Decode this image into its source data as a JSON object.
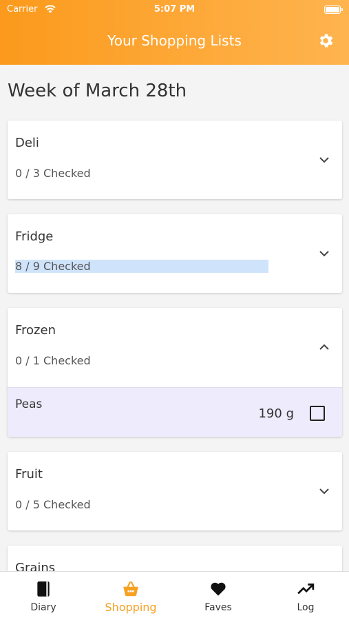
{
  "status": {
    "carrier": "Carrier",
    "time": "5:07 PM"
  },
  "header": {
    "title": "Your Shopping Lists"
  },
  "week_title": "Week of March 28th",
  "lists": [
    {
      "name": "Deli",
      "count": "0 / 3 Checked",
      "expanded": false
    },
    {
      "name": "Fridge",
      "count": "8 / 9 Checked",
      "expanded": false
    },
    {
      "name": "Frozen",
      "count": "0 / 1 Checked",
      "expanded": true,
      "items": [
        {
          "name": "Peas",
          "qty": "190 g",
          "checked": false
        }
      ]
    },
    {
      "name": "Fruit",
      "count": "0 / 5 Checked",
      "expanded": false
    },
    {
      "name": "Grains",
      "count": "",
      "expanded": false
    }
  ],
  "tabs": [
    {
      "label": "Diary",
      "icon": "diary-icon",
      "active": false
    },
    {
      "label": "Shopping",
      "icon": "basket-icon",
      "active": true
    },
    {
      "label": "Faves",
      "icon": "heart-icon",
      "active": false
    },
    {
      "label": "Log",
      "icon": "trend-icon",
      "active": false
    }
  ],
  "colors": {
    "accent": "#f6a123",
    "header_start": "#fb9a1c",
    "header_end": "#ffb44f",
    "subitem_bg": "#eeecfc",
    "highlight": "#cfe3fb"
  }
}
